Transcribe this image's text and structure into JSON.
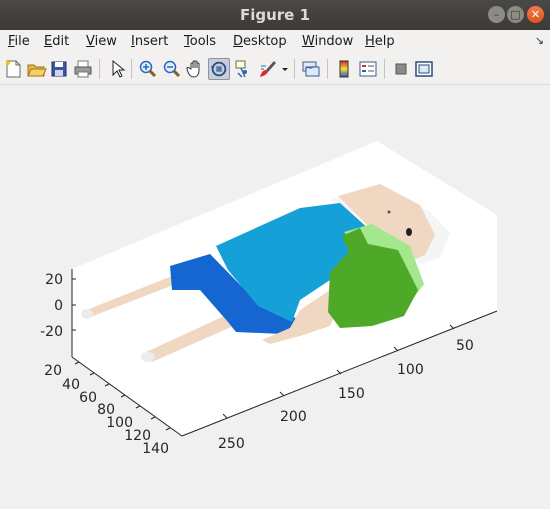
{
  "window": {
    "title": "Figure 1"
  },
  "menu": {
    "items": [
      {
        "label": "File",
        "key": "F",
        "rest": "ile"
      },
      {
        "label": "Edit",
        "key": "E",
        "rest": "dit"
      },
      {
        "label": "View",
        "key": "V",
        "rest": "iew"
      },
      {
        "label": "Insert",
        "key": "I",
        "rest": "nsert"
      },
      {
        "label": "Tools",
        "key": "T",
        "rest": "ools"
      },
      {
        "label": "Desktop",
        "key": "D",
        "rest": "esktop"
      },
      {
        "label": "Window",
        "key": "W",
        "rest": "indow"
      },
      {
        "label": "Help",
        "key": "H",
        "rest": "elp"
      }
    ],
    "corner_icon": "dock-arrow-icon"
  },
  "toolbar": {
    "buttons": [
      "new-figure",
      "open-file",
      "save",
      "print",
      "edit-plot",
      "zoom-in",
      "zoom-out",
      "pan",
      "rotate-3d",
      "data-cursor",
      "brush",
      "brush-dropdown",
      "link-plot",
      "insert-colorbar",
      "insert-legend",
      "hide-plot-tools",
      "show-plot-tools"
    ],
    "pressed": "rotate-3d"
  },
  "axes": {
    "z_ticks": [
      "20",
      "0",
      "-20"
    ],
    "y_ticks": [
      "20",
      "40",
      "60",
      "80",
      "100",
      "120",
      "140"
    ],
    "x_ticks": [
      "50",
      "100",
      "150",
      "200",
      "250"
    ]
  },
  "colors": {
    "shirt_light": "#16a0d8",
    "shirt_dark": "#1666d2",
    "skin": "#f0d7c1",
    "backpack": "#4fa928",
    "backpack_light": "#a3e88c",
    "hat": "#f5f5f5"
  }
}
